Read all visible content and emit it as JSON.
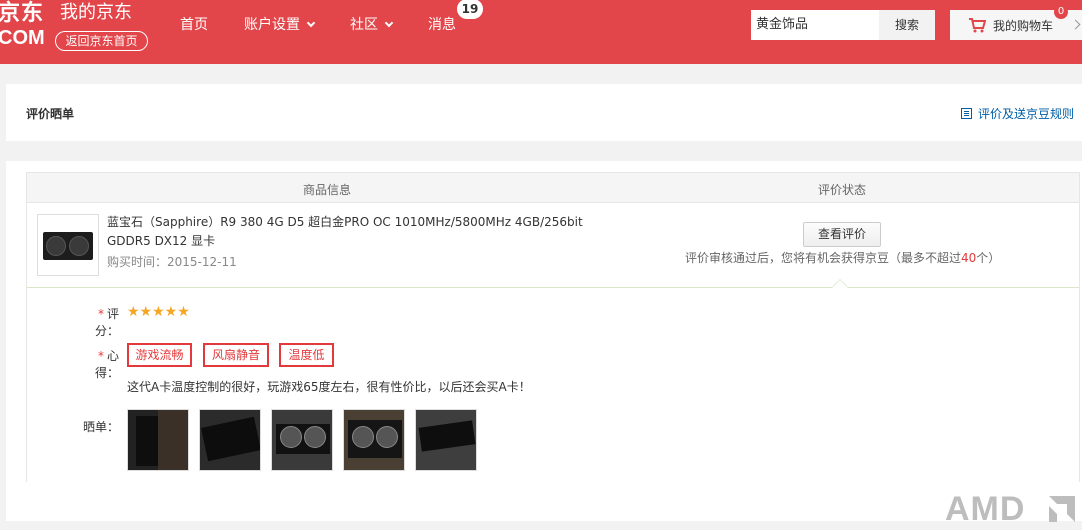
{
  "header": {
    "logo_top": "京东",
    "logo_bottom": "COM",
    "site_title": "我的京东",
    "back_home": "返回京东首页",
    "nav": [
      {
        "label": "首页"
      },
      {
        "label": "账户设置"
      },
      {
        "label": "社区"
      },
      {
        "label": "消息",
        "badge": "19"
      }
    ],
    "search_value": "黄金饰品",
    "search_button": "搜索",
    "cart_label": "我的购物车",
    "cart_count": "0",
    "accent_color": "#e2464b"
  },
  "section": {
    "title": "评价晒单",
    "rules_link": "评价及送京豆规则"
  },
  "table": {
    "col_product": "商品信息",
    "col_status": "评价状态"
  },
  "order": {
    "product_name": "蓝宝石（Sapphire）R9 380 4G D5 超白金PRO OC 1010MHz/5800MHz 4GB/256bit GDDR5 DX12 显卡",
    "buy_date": "购买时间：2015-12-11",
    "view_button": "查看评价",
    "beans_note_prefix": "评价审核通过后，您将有机会获得京豆（最多不超过",
    "beans_max": "40",
    "beans_note_suffix": "个）"
  },
  "review": {
    "rating_label": "评分：",
    "rating_stars": 5,
    "stars_text": "★★★★★",
    "experience_label": "心得：",
    "tags": [
      "游戏流畅",
      "风扇静音",
      "温度低"
    ],
    "text": "这代A卡温度控制的很好，玩游戏65度左右，很有性价比，以后还会买A卡！",
    "photos_label": "晒单：",
    "photo_count": 5
  },
  "watermark": "AMD"
}
